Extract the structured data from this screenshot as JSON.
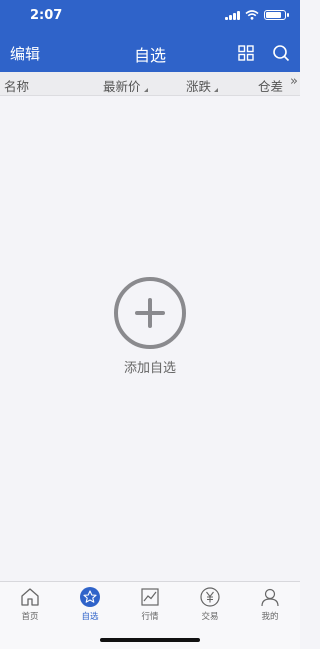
{
  "status": {
    "time": "2:07"
  },
  "nav": {
    "edit": "编辑",
    "title": "自选"
  },
  "columns": {
    "name": "名称",
    "latest_price": "最新价",
    "change": "涨跌",
    "open_interest_change": "仓差",
    "more": "»"
  },
  "empty_state": {
    "label": "添加自选"
  },
  "tabs": [
    {
      "label": "首页",
      "icon": "home-icon"
    },
    {
      "label": "自选",
      "icon": "star-icon",
      "active": true
    },
    {
      "label": "行情",
      "icon": "chart-icon"
    },
    {
      "label": "交易",
      "icon": "yen-icon"
    },
    {
      "label": "我的",
      "icon": "person-icon"
    }
  ],
  "colors": {
    "primary": "#2f63c9",
    "background": "#f4f4f8"
  }
}
